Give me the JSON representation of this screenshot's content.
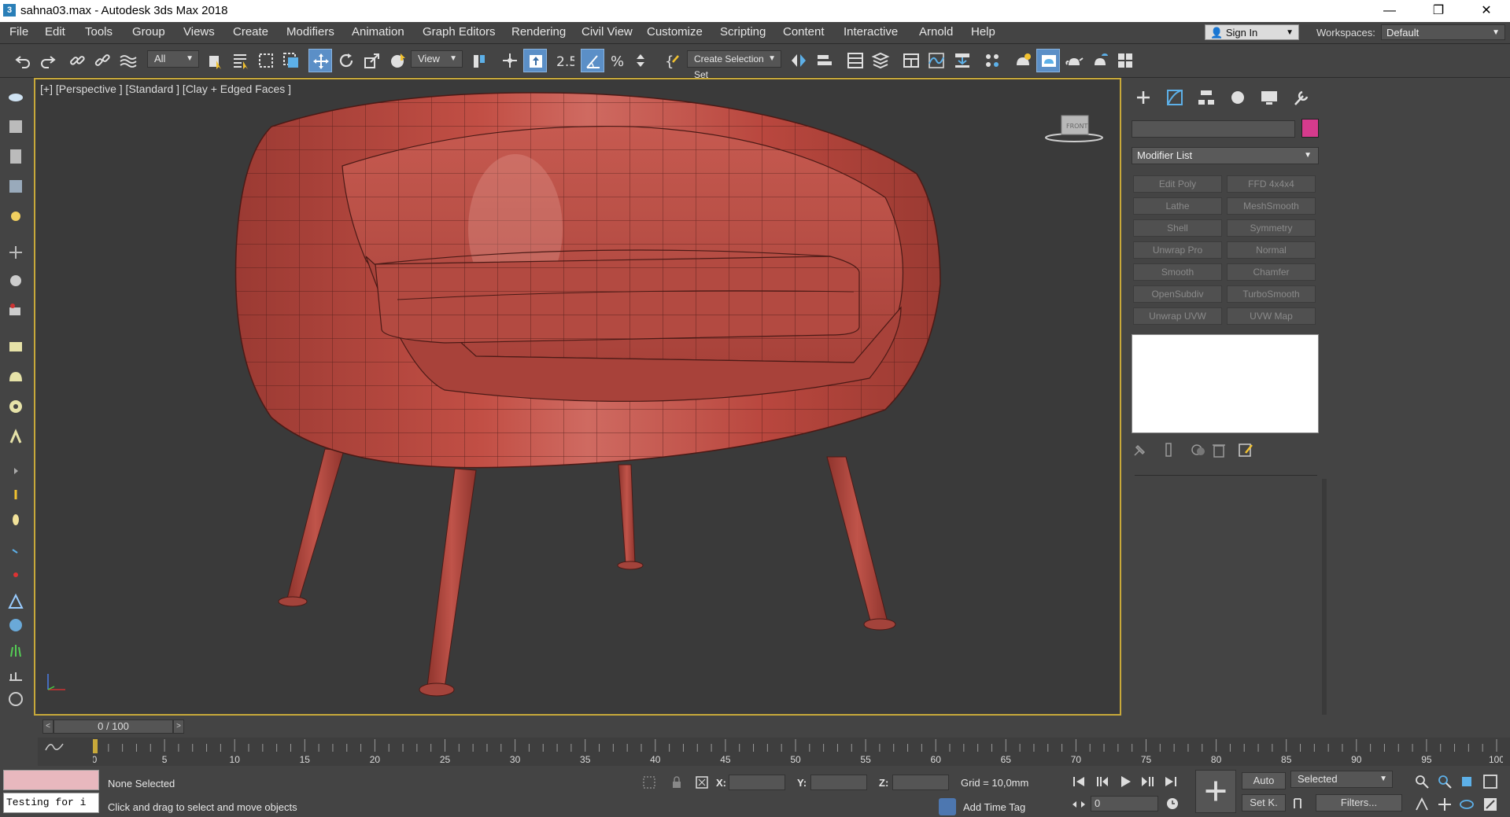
{
  "window": {
    "title": "sahna03.max - Autodesk 3ds Max 2018",
    "app_icon": "3",
    "controls": {
      "minimize": "—",
      "maximize": "❐",
      "close": "✕"
    }
  },
  "menu": [
    "File",
    "Edit",
    "Tools",
    "Group",
    "Views",
    "Create",
    "Modifiers",
    "Animation",
    "Graph Editors",
    "Rendering",
    "Civil View",
    "Customize",
    "Scripting",
    "Content",
    "Interactive",
    "Arnold",
    "Help"
  ],
  "account": {
    "sign_in": "Sign In",
    "workspaces_label": "Workspaces:",
    "workspace_value": "Default"
  },
  "toolbar": {
    "filter_value": "All",
    "ref_coord_value": "View",
    "snap_label": "2.5",
    "selection_set_value": "Create Selection Set"
  },
  "viewport": {
    "label": "[+] [Perspective ] [Standard ] [Clay + Edged Faces ]",
    "viewcube_face": "FRONT",
    "model_color": "#b2463d",
    "background": "#3a3a3a"
  },
  "command_panel": {
    "tabs": [
      "create-tab",
      "modify-tab",
      "hierarchy-tab",
      "motion-tab",
      "display-tab",
      "utilities-tab"
    ],
    "object_color": "#d63b8d",
    "modifier_list_label": "Modifier List",
    "modifier_buttons": [
      [
        "Edit Poly",
        "FFD 4x4x4"
      ],
      [
        "Lathe",
        "MeshSmooth"
      ],
      [
        "Shell",
        "Symmetry"
      ],
      [
        "Unwrap Pro",
        "Normal"
      ],
      [
        "Smooth",
        "Chamfer"
      ],
      [
        "OpenSubdiv",
        "TurboSmooth"
      ],
      [
        "Unwrap UVW",
        "UVW Map"
      ]
    ]
  },
  "time_slider": {
    "value": "0 / 100",
    "prev": "<",
    "next": ">"
  },
  "track_bar": {
    "ticks": [
      "0",
      "5",
      "10",
      "15",
      "20",
      "25",
      "30",
      "35",
      "40",
      "45",
      "50",
      "55",
      "60",
      "65",
      "70",
      "75",
      "80",
      "85",
      "90",
      "95",
      "100"
    ]
  },
  "status": {
    "listener_text": "Testing for i",
    "selection": "None Selected",
    "prompt": "Click and drag to select and move objects",
    "x_label": "X:",
    "y_label": "Y:",
    "z_label": "Z:",
    "grid": "Grid = 10,0mm",
    "add_time_tag": "Add Time Tag",
    "auto_key": "Auto",
    "set_key": "Set K.",
    "key_filter_value": "Selected",
    "filters": "Filters...",
    "frame_value": "0"
  }
}
